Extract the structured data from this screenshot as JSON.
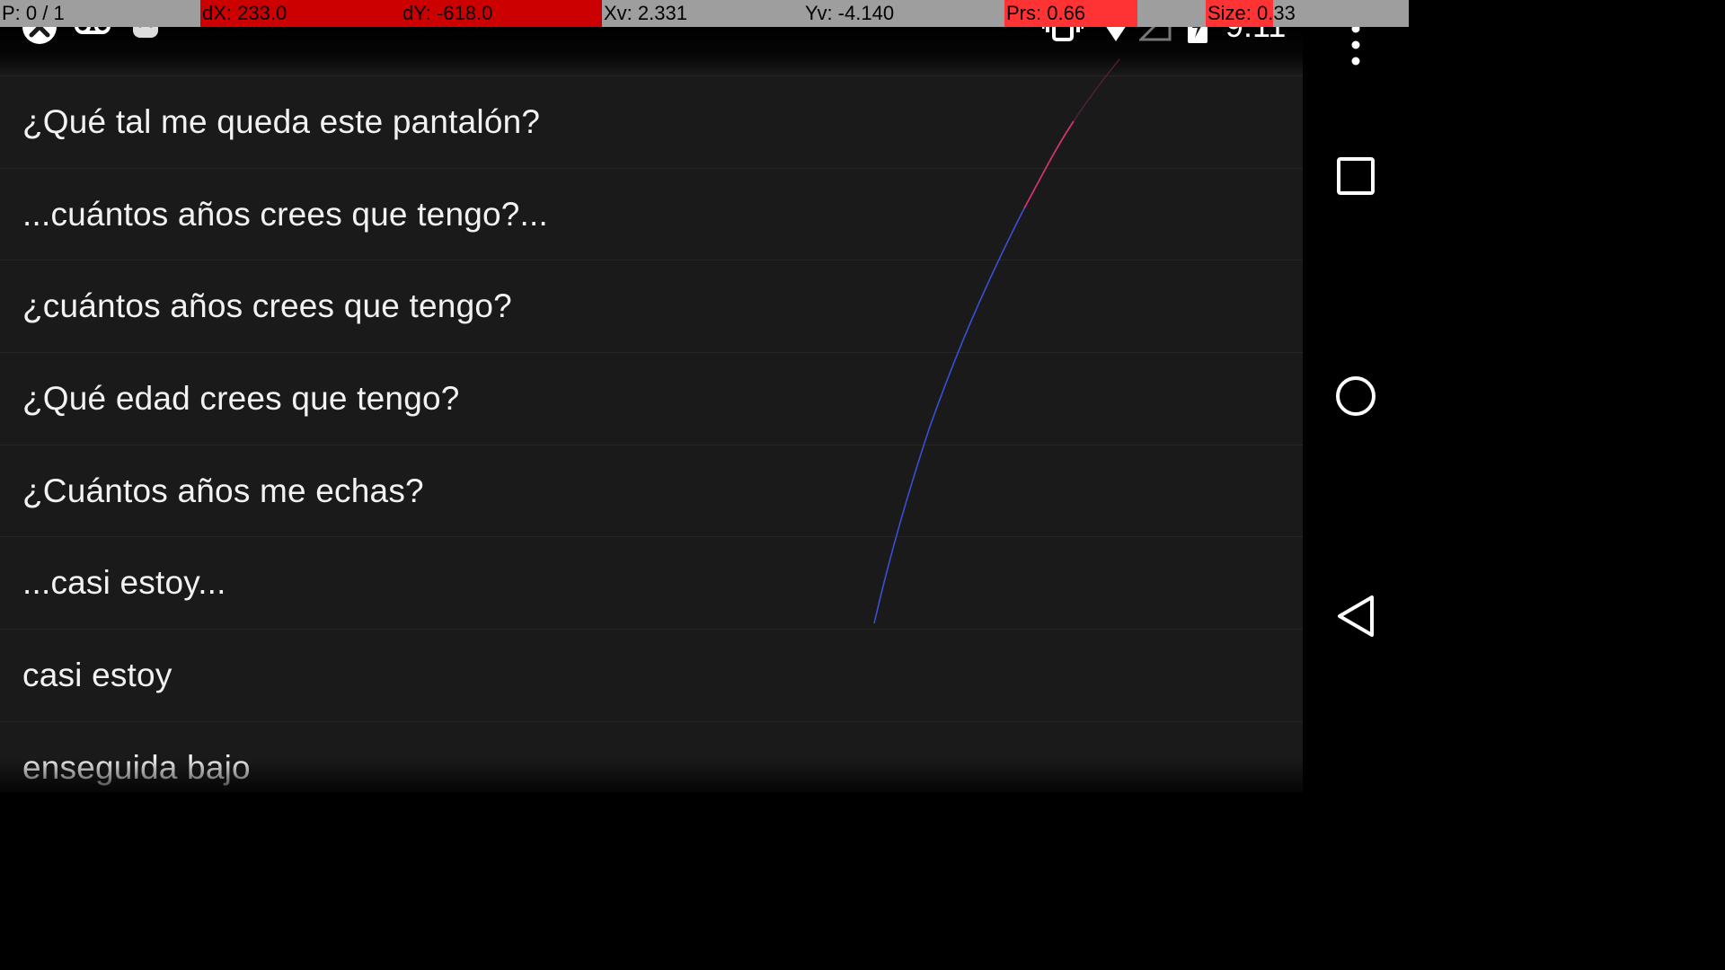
{
  "pointer_overlay": {
    "pointers": "P: 0 / 1",
    "dx": "dX: 233.0",
    "dy": "dY: -618.0",
    "xv": "Xv: 2.331",
    "yv": "Yv: -4.140",
    "prs": "Prs: 0.66",
    "size": "Size: 0.33",
    "colors": {
      "neutral": "#9e9e9e",
      "highlight": "#cc0000",
      "pressure_fill": "#ff3333"
    }
  },
  "status_bar": {
    "time": "9:11",
    "left_icons": [
      "close-circle-icon",
      "voicemail-icon",
      "android-debug-icon"
    ],
    "right_icons": [
      "vibrate-icon",
      "wifi-icon",
      "cell-signal-icon",
      "battery-charging-icon"
    ]
  },
  "list": {
    "items": [
      "¿Qué tal me queda este pantalón?",
      "...cuántos años crees que tengo?...",
      "¿cuántos años crees que tengo?",
      "¿Qué edad crees que tengo?",
      "¿Cuántos años me echas?",
      "...casi estoy...",
      "casi estoy",
      "enseguida bajo"
    ],
    "background": "#1a1a1a",
    "text_color": "#f2f2f2"
  },
  "nav_bar": {
    "buttons": [
      "more-options",
      "recents",
      "home",
      "back"
    ]
  },
  "touch_trace": {
    "colors": [
      "#3a4fd6",
      "#e0306a"
    ]
  }
}
